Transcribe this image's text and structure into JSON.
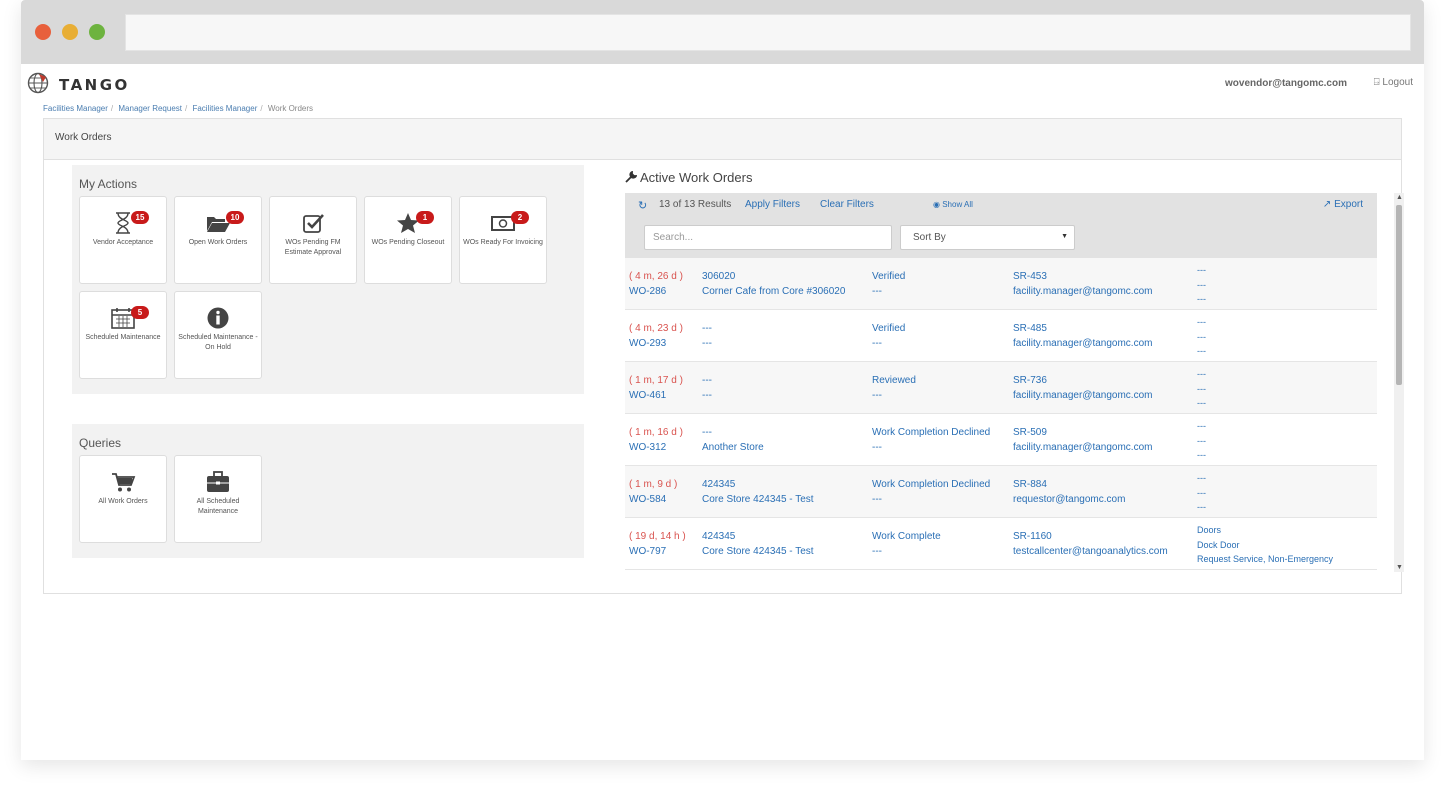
{
  "app": {
    "logo_text": "TANGO",
    "user_email": "wovendor@tangomc.com",
    "logout_label": "Logout",
    "breadcrumb": [
      "Facilities Manager",
      "Manager Request",
      "Facilities Manager",
      "Work Orders"
    ],
    "panel_title": "Work Orders"
  },
  "my_actions": {
    "title": "My Actions",
    "tiles": [
      {
        "label": "Vendor Acceptance",
        "badge": "15",
        "icon": "hourglass-icon"
      },
      {
        "label": "Open Work Orders",
        "badge": "10",
        "icon": "folder-open-icon"
      },
      {
        "label": "WOs Pending FM Estimate Approval",
        "badge": "",
        "icon": "checkbox-icon"
      },
      {
        "label": "WOs Pending Closeout",
        "badge": "1",
        "icon": "star-icon"
      },
      {
        "label": "WOs Ready For Invoicing",
        "badge": "2",
        "icon": "money-icon"
      },
      {
        "label": "Scheduled Maintenance",
        "badge": "5",
        "icon": "calendar-icon"
      },
      {
        "label": "Scheduled Maintenance - On Hold",
        "badge": "",
        "icon": "info-icon"
      }
    ]
  },
  "queries": {
    "title": "Queries",
    "tiles": [
      {
        "label": "All Work Orders",
        "icon": "cart-icon"
      },
      {
        "label": "All Scheduled Maintenance",
        "icon": "briefcase-icon"
      }
    ]
  },
  "active_work_orders": {
    "title": "Active Work Orders",
    "results": "13 of 13 Results",
    "apply_filters": "Apply Filters",
    "clear_filters": "Clear Filters",
    "show_all": "Show All",
    "export": "Export",
    "search_placeholder": "Search...",
    "sort_by": "Sort By",
    "rows": [
      {
        "age": "( 4 m, 26 d )",
        "wo": "WO-286",
        "num": "306020",
        "store": "Corner Cafe from Core #306020",
        "status": "Verified",
        "status2": "---",
        "sr": "SR-453",
        "email": "facility.manager@tangomc.com",
        "m1": "---",
        "m2": "---",
        "m3": "---"
      },
      {
        "age": "( 4 m, 23 d )",
        "wo": "WO-293",
        "num": "---",
        "store": "---",
        "status": "Verified",
        "status2": "---",
        "sr": "SR-485",
        "email": "facility.manager@tangomc.com",
        "m1": "---",
        "m2": "---",
        "m3": "---"
      },
      {
        "age": "( 1 m, 17 d )",
        "wo": "WO-461",
        "num": "---",
        "store": "---",
        "status": "Reviewed",
        "status2": "---",
        "sr": "SR-736",
        "email": "facility.manager@tangomc.com",
        "m1": "---",
        "m2": "---",
        "m3": "---"
      },
      {
        "age": "( 1 m, 16 d )",
        "wo": "WO-312",
        "num": "---",
        "store": "Another Store",
        "status": "Work Completion Declined",
        "status2": "---",
        "sr": "SR-509",
        "email": "facility.manager@tangomc.com",
        "m1": "---",
        "m2": "---",
        "m3": "---"
      },
      {
        "age": "( 1 m, 9 d )",
        "wo": "WO-584",
        "num": "424345",
        "store": "Core Store 424345 - Test",
        "status": "Work Completion Declined",
        "status2": "---",
        "sr": "SR-884",
        "email": "requestor@tangomc.com",
        "m1": "---",
        "m2": "---",
        "m3": "---"
      },
      {
        "age": "( 19 d, 14 h )",
        "wo": "WO-797",
        "num": "424345",
        "store": "Core Store 424345 - Test",
        "status": "Work Complete",
        "status2": "---",
        "sr": "SR-1160",
        "email": "testcallcenter@tangoanalytics.com",
        "m1": "Doors",
        "m2": "Dock Door",
        "m3": "Request Service, Non-Emergency"
      }
    ]
  },
  "colors": {
    "link": "#2a6fb5",
    "overdue": "#d9534f",
    "badge": "#c81a1a"
  }
}
